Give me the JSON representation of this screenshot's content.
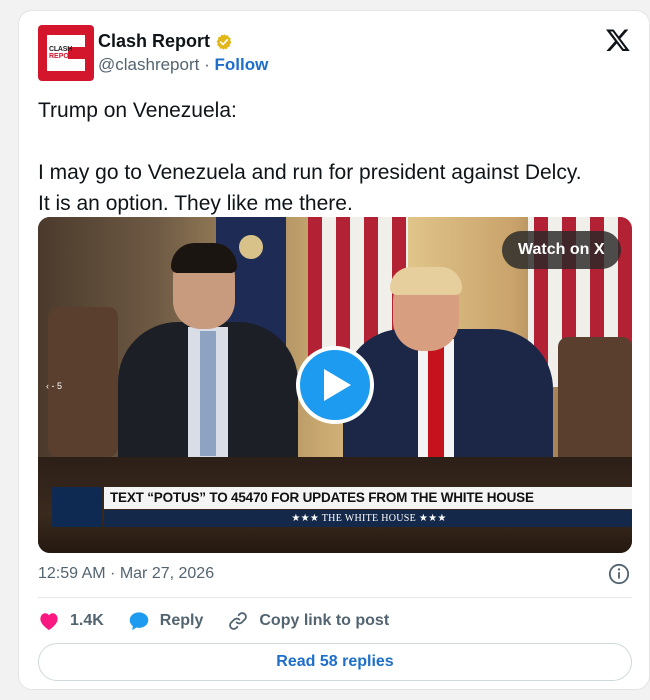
{
  "author": {
    "display_name": "Clash Report",
    "handle": "@clashreport",
    "separator": "·",
    "follow_label": "Follow",
    "avatar_text_line1": "CLASH",
    "avatar_text_line2": "REPORT"
  },
  "tweet": {
    "line1": "Trump on Venezuela:",
    "line2": "I may go to Venezuela and run for president against Delcy.",
    "line3": "It is an option. They like me there."
  },
  "media": {
    "watch_label": "Watch on X",
    "chyron_main": "TEXT “POTUS” TO 45470 FOR UPDATES FROM THE WHITE HOUSE",
    "chyron_sub": "★★★  THE WHITE HOUSE  ★★★",
    "side_marker": "‹ - 5"
  },
  "footer": {
    "timestamp": "12:59 AM · Mar 27, 2026",
    "likes_count": "1.4K",
    "reply_label": "Reply",
    "copy_link_label": "Copy link to post",
    "read_replies_label": "Read 58 replies"
  },
  "colors": {
    "accent_blue": "#1d9bf0",
    "link_blue": "#1d6fc9",
    "like_pink": "#f91880",
    "brand_red": "#d3162c",
    "verified_gold": "#e2b719"
  },
  "icons": [
    "verified-badge-icon",
    "x-logo-icon",
    "play-icon",
    "info-icon",
    "heart-icon",
    "reply-bubble-icon",
    "link-icon"
  ]
}
